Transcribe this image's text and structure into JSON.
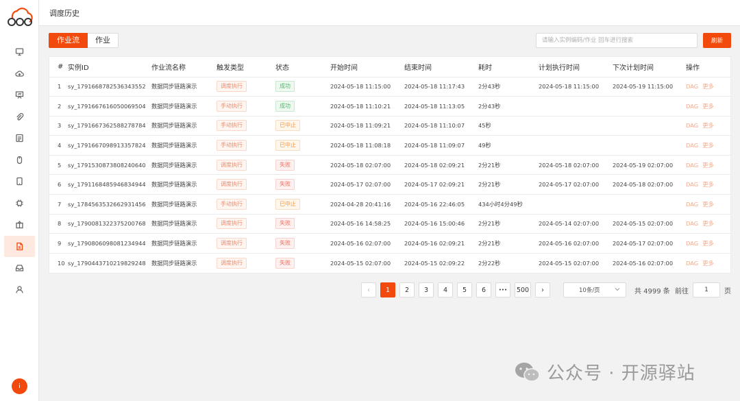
{
  "header": {
    "title": "调度历史"
  },
  "toolbar": {
    "tabs": [
      {
        "label": "作业流"
      },
      {
        "label": "作业"
      }
    ],
    "search_placeholder": "请输入实例编码/作业 回车进行搜索",
    "refresh_label": "刷新"
  },
  "sidebar": {
    "icons": [
      "monitor-icon",
      "cloud-upload-icon",
      "presentation-icon",
      "paperclip-icon",
      "image-icon",
      "mouse-icon",
      "tablet-icon",
      "chip-icon",
      "package-icon",
      "document-icon",
      "inbox-icon",
      "user-icon"
    ],
    "active_index": 9,
    "avatar_label": "i"
  },
  "table": {
    "columns": [
      "#",
      "实例ID",
      "作业流名称",
      "触发类型",
      "状态",
      "开始时间",
      "结束时间",
      "耗时",
      "计划执行时间",
      "下次计划时间",
      "操作"
    ],
    "rows": [
      [
        "1",
        "sy_1791668782536343552",
        "数据同步链路演示",
        "调度执行",
        "成功",
        "2024-05-18 11:15:00",
        "2024-05-18 11:17:43",
        "2分43秒",
        "2024-05-18 11:15:00",
        "2024-05-19 11:15:00"
      ],
      [
        "2",
        "sy_1791667616050069504",
        "数据同步链路演示",
        "手动执行",
        "成功",
        "2024-05-18 11:10:21",
        "2024-05-18 11:13:05",
        "2分43秒",
        "",
        ""
      ],
      [
        "3",
        "sy_1791667362588278784",
        "数据同步链路演示",
        "手动执行",
        "已中止",
        "2024-05-18 11:09:21",
        "2024-05-18 11:10:07",
        "45秒",
        "",
        ""
      ],
      [
        "4",
        "sy_1791667098913357824",
        "数据同步链路演示",
        "手动执行",
        "已中止",
        "2024-05-18 11:08:18",
        "2024-05-18 11:09:07",
        "49秒",
        "",
        ""
      ],
      [
        "5",
        "sy_1791530873808240640",
        "数据同步链路演示",
        "调度执行",
        "失败",
        "2024-05-18 02:07:00",
        "2024-05-18 02:09:21",
        "2分21秒",
        "2024-05-18 02:07:00",
        "2024-05-19 02:07:00"
      ],
      [
        "6",
        "sy_1791168485946834944",
        "数据同步链路演示",
        "调度执行",
        "失败",
        "2024-05-17 02:07:00",
        "2024-05-17 02:09:21",
        "2分21秒",
        "2024-05-17 02:07:00",
        "2024-05-18 02:07:00"
      ],
      [
        "7",
        "sy_1784563532662931456",
        "数据同步链路演示",
        "手动执行",
        "已中止",
        "2024-04-28 20:41:16",
        "2024-05-16 22:46:05",
        "434小时4分49秒",
        "",
        ""
      ],
      [
        "8",
        "sy_1790081322375200768",
        "数据同步链路演示",
        "调度执行",
        "失败",
        "2024-05-16 14:58:25",
        "2024-05-16 15:00:46",
        "2分21秒",
        "2024-05-14 02:07:00",
        "2024-05-15 02:07:00"
      ],
      [
        "9",
        "sy_1790806098081234944",
        "数据同步链路演示",
        "调度执行",
        "失败",
        "2024-05-16 02:07:00",
        "2024-05-16 02:09:21",
        "2分21秒",
        "2024-05-16 02:07:00",
        "2024-05-17 02:07:00"
      ],
      [
        "10",
        "sy_1790443710219829248",
        "数据同步链路演示",
        "调度执行",
        "失败",
        "2024-05-15 02:07:00",
        "2024-05-15 02:09:22",
        "2分22秒",
        "2024-05-15 02:07:00",
        "2024-05-16 02:07:00"
      ]
    ],
    "actions": [
      "DAG",
      "更多"
    ]
  },
  "status_colors": {
    "成功": "st-ok",
    "已中止": "st-stop",
    "失败": "st-fail"
  },
  "pagination": {
    "prev": "‹",
    "pages": [
      "1",
      "2",
      "3",
      "4",
      "5",
      "6"
    ],
    "ellipsis": "•••",
    "last": "500",
    "next": "›",
    "current": "1",
    "page_size": "10条/页",
    "total": "共 4999 条",
    "goto_label": "前往",
    "goto_value": "1",
    "goto_suffix": "页"
  },
  "watermark": {
    "text": "公众号 · 开源驿站"
  },
  "colors": {
    "accent": "#f24a0c"
  }
}
